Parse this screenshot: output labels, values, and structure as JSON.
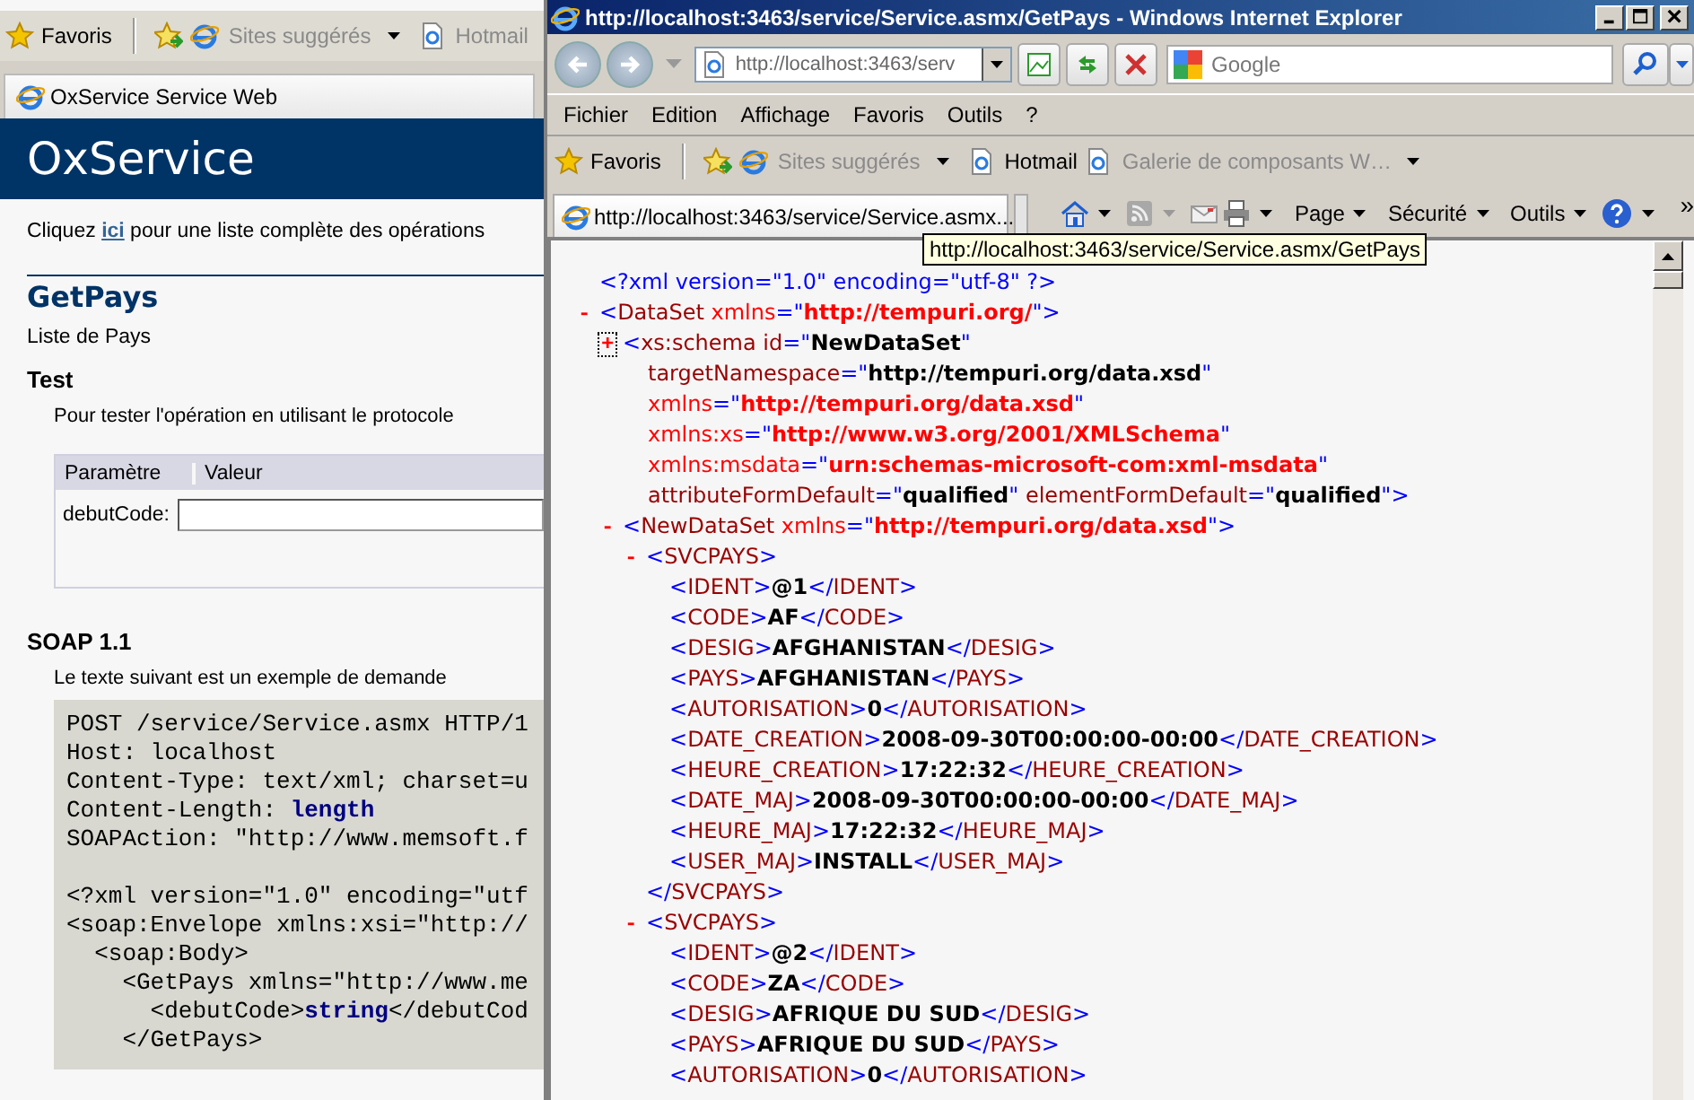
{
  "background_window": {
    "favorites_bar": {
      "favorites_label": "Favoris",
      "links": [
        {
          "label": "Sites suggérés",
          "dropdown": true
        },
        {
          "label": "Hotmail",
          "dropdown": false
        }
      ]
    },
    "tab": {
      "title": "OxService Service Web"
    },
    "page": {
      "header": "OxService",
      "intro": {
        "before": "Cliquez",
        "link": "ici",
        "after": "pour une liste complète des opérations"
      },
      "operation_title": "GetPays",
      "operation_description": "Liste de Pays",
      "test_heading": "Test",
      "test_instruction": "Pour tester l'opération en utilisant le protocole",
      "parameters_table": {
        "columns": [
          "Paramètre",
          "Valeur"
        ],
        "rows": [
          {
            "name": "debutCode:"
          }
        ]
      },
      "soap_heading": "SOAP 1.1",
      "soap_intro": "Le texte suivant est un exemple de demande",
      "soap_request_blocks": [
        [
          "POST /service/Service.asmx HTTP/1",
          "Host: localhost",
          "Content-Type: text/xml; charset=u",
          "Content-Length: **length**",
          "SOAPAction: \"http://www.memsoft.f"
        ],
        [
          "<?xml version=\"1.0\" encoding=\"utf",
          "<soap:Envelope xmlns:xsi=\"http://",
          "  <soap:Body>",
          "    <GetPays xmlns=\"http://www.me",
          "      <debutCode>**string**</debutCod",
          "    </GetPays>"
        ]
      ]
    }
  },
  "window": {
    "title": "http://localhost:3463/service/Service.asmx/GetPays - Windows Internet Explorer",
    "address_bar": {
      "url": "http://localhost:3463/serv"
    },
    "search": {
      "placeholder": "Google"
    },
    "menu": [
      "Fichier",
      "Edition",
      "Affichage",
      "Favoris",
      "Outils",
      "?"
    ],
    "favorites_bar": {
      "favorites_label": "Favoris",
      "suggested": {
        "label": "Sites suggérés",
        "disabled": true
      },
      "links": [
        {
          "label": "Hotmail",
          "disabled": false,
          "dropdown": false
        },
        {
          "label": "Galerie de composants W…",
          "disabled": true,
          "dropdown": true
        }
      ]
    },
    "tabs": [
      {
        "title": "http://localhost:3463/service/Service.asmx...",
        "selected": true
      }
    ],
    "command_menus": [
      "Page",
      "Sécurité",
      "Outils"
    ],
    "overflow": "»",
    "tooltip": "http://localhost:3463/service/Service.asmx/GetPays",
    "xml": {
      "nodes": [
        {
          "lines": [
            [
              {
                "kind": "pi",
                "text": "<?xml version=\"1.0\" encoding=\"utf-8\" ?>"
              }
            ]
          ]
        },
        {
          "toggle": "-",
          "focused": false,
          "lines": [
            [
              {
                "kind": "m",
                "text": "<"
              },
              {
                "kind": "n",
                "text": "DataSet"
              },
              {
                "kind": "ns",
                "text": " xmlns"
              },
              {
                "kind": "m",
                "text": "=\""
              },
              {
                "kind": "nsv",
                "text": "http://tempuri.org/"
              },
              {
                "kind": "m",
                "text": "\">"
              }
            ]
          ],
          "children": [
            {
              "toggle": "+",
              "focused": true,
              "lines": [
                [
                  {
                    "kind": "m",
                    "text": "<"
                  },
                  {
                    "kind": "n",
                    "text": "xs:schema"
                  },
                  {
                    "kind": "a",
                    "text": " id"
                  },
                  {
                    "kind": "m",
                    "text": "=\""
                  },
                  {
                    "kind": "v",
                    "text": "NewDataSet"
                  },
                  {
                    "kind": "m",
                    "text": "\""
                  }
                ],
                [
                  {
                    "kind": "a",
                    "text": "targetNamespace"
                  },
                  {
                    "kind": "m",
                    "text": "=\""
                  },
                  {
                    "kind": "v",
                    "text": "http://tempuri.org/data.xsd"
                  },
                  {
                    "kind": "m",
                    "text": "\""
                  }
                ],
                [
                  {
                    "kind": "ns",
                    "text": "xmlns"
                  },
                  {
                    "kind": "m",
                    "text": "=\""
                  },
                  {
                    "kind": "nsv",
                    "text": "http://tempuri.org/data.xsd"
                  },
                  {
                    "kind": "m",
                    "text": "\""
                  }
                ],
                [
                  {
                    "kind": "ns",
                    "text": "xmlns:xs"
                  },
                  {
                    "kind": "m",
                    "text": "=\""
                  },
                  {
                    "kind": "nsv",
                    "text": "http://www.w3.org/2001/XMLSchema"
                  },
                  {
                    "kind": "m",
                    "text": "\""
                  }
                ],
                [
                  {
                    "kind": "ns",
                    "text": "xmlns:msdata"
                  },
                  {
                    "kind": "m",
                    "text": "=\""
                  },
                  {
                    "kind": "nsv",
                    "text": "urn:schemas-microsoft-com:xml-msdata"
                  },
                  {
                    "kind": "m",
                    "text": "\""
                  }
                ],
                [
                  {
                    "kind": "a",
                    "text": "attributeFormDefault"
                  },
                  {
                    "kind": "m",
                    "text": "=\""
                  },
                  {
                    "kind": "v",
                    "text": "qualified"
                  },
                  {
                    "kind": "m",
                    "text": "\""
                  },
                  {
                    "kind": "a",
                    "text": " elementFormDefault"
                  },
                  {
                    "kind": "m",
                    "text": "=\""
                  },
                  {
                    "kind": "v",
                    "text": "qualified"
                  },
                  {
                    "kind": "m",
                    "text": "\">"
                  }
                ]
              ]
            },
            {
              "toggle": "-",
              "focused": false,
              "lines": [
                [
                  {
                    "kind": "m",
                    "text": "<"
                  },
                  {
                    "kind": "n",
                    "text": "NewDataSet"
                  },
                  {
                    "kind": "ns",
                    "text": " xmlns"
                  },
                  {
                    "kind": "m",
                    "text": "=\""
                  },
                  {
                    "kind": "nsv",
                    "text": "http://tempuri.org/data.xsd"
                  },
                  {
                    "kind": "m",
                    "text": "\">"
                  }
                ]
              ],
              "children": [
                {
                  "toggle": "-",
                  "focused": false,
                  "lines": [
                    [
                      {
                        "kind": "m",
                        "text": "<"
                      },
                      {
                        "kind": "n",
                        "text": "SVCPAYS"
                      },
                      {
                        "kind": "m",
                        "text": ">"
                      }
                    ]
                  ],
                  "close": [
                    {
                      "kind": "m",
                      "text": "</"
                    },
                    {
                      "kind": "n",
                      "text": "SVCPAYS"
                    },
                    {
                      "kind": "m",
                      "text": ">"
                    }
                  ],
                  "children": [
                    {
                      "lines": [
                        [
                          {
                            "kind": "m",
                            "text": "<"
                          },
                          {
                            "kind": "n",
                            "text": "IDENT"
                          },
                          {
                            "kind": "m",
                            "text": ">"
                          },
                          {
                            "kind": "t",
                            "text": "@1"
                          },
                          {
                            "kind": "m",
                            "text": "</"
                          },
                          {
                            "kind": "n",
                            "text": "IDENT"
                          },
                          {
                            "kind": "m",
                            "text": ">"
                          }
                        ]
                      ]
                    },
                    {
                      "lines": [
                        [
                          {
                            "kind": "m",
                            "text": "<"
                          },
                          {
                            "kind": "n",
                            "text": "CODE"
                          },
                          {
                            "kind": "m",
                            "text": ">"
                          },
                          {
                            "kind": "t",
                            "text": "AF"
                          },
                          {
                            "kind": "m",
                            "text": "</"
                          },
                          {
                            "kind": "n",
                            "text": "CODE"
                          },
                          {
                            "kind": "m",
                            "text": ">"
                          }
                        ]
                      ]
                    },
                    {
                      "lines": [
                        [
                          {
                            "kind": "m",
                            "text": "<"
                          },
                          {
                            "kind": "n",
                            "text": "DESIG"
                          },
                          {
                            "kind": "m",
                            "text": ">"
                          },
                          {
                            "kind": "t",
                            "text": "AFGHANISTAN"
                          },
                          {
                            "kind": "m",
                            "text": "</"
                          },
                          {
                            "kind": "n",
                            "text": "DESIG"
                          },
                          {
                            "kind": "m",
                            "text": ">"
                          }
                        ]
                      ]
                    },
                    {
                      "lines": [
                        [
                          {
                            "kind": "m",
                            "text": "<"
                          },
                          {
                            "kind": "n",
                            "text": "PAYS"
                          },
                          {
                            "kind": "m",
                            "text": ">"
                          },
                          {
                            "kind": "t",
                            "text": "AFGHANISTAN"
                          },
                          {
                            "kind": "m",
                            "text": "</"
                          },
                          {
                            "kind": "n",
                            "text": "PAYS"
                          },
                          {
                            "kind": "m",
                            "text": ">"
                          }
                        ]
                      ]
                    },
                    {
                      "lines": [
                        [
                          {
                            "kind": "m",
                            "text": "<"
                          },
                          {
                            "kind": "n",
                            "text": "AUTORISATION"
                          },
                          {
                            "kind": "m",
                            "text": ">"
                          },
                          {
                            "kind": "t",
                            "text": "0"
                          },
                          {
                            "kind": "m",
                            "text": "</"
                          },
                          {
                            "kind": "n",
                            "text": "AUTORISATION"
                          },
                          {
                            "kind": "m",
                            "text": ">"
                          }
                        ]
                      ]
                    },
                    {
                      "lines": [
                        [
                          {
                            "kind": "m",
                            "text": "<"
                          },
                          {
                            "kind": "n",
                            "text": "DATE_CREATION"
                          },
                          {
                            "kind": "m",
                            "text": ">"
                          },
                          {
                            "kind": "t",
                            "text": "2008-09-30T00:00:00-00:00"
                          },
                          {
                            "kind": "m",
                            "text": "</"
                          },
                          {
                            "kind": "n",
                            "text": "DATE_CREATION"
                          },
                          {
                            "kind": "m",
                            "text": ">"
                          }
                        ]
                      ]
                    },
                    {
                      "lines": [
                        [
                          {
                            "kind": "m",
                            "text": "<"
                          },
                          {
                            "kind": "n",
                            "text": "HEURE_CREATION"
                          },
                          {
                            "kind": "m",
                            "text": ">"
                          },
                          {
                            "kind": "t",
                            "text": "17:22:32"
                          },
                          {
                            "kind": "m",
                            "text": "</"
                          },
                          {
                            "kind": "n",
                            "text": "HEURE_CREATION"
                          },
                          {
                            "kind": "m",
                            "text": ">"
                          }
                        ]
                      ]
                    },
                    {
                      "lines": [
                        [
                          {
                            "kind": "m",
                            "text": "<"
                          },
                          {
                            "kind": "n",
                            "text": "DATE_MAJ"
                          },
                          {
                            "kind": "m",
                            "text": ">"
                          },
                          {
                            "kind": "t",
                            "text": "2008-09-30T00:00:00-00:00"
                          },
                          {
                            "kind": "m",
                            "text": "</"
                          },
                          {
                            "kind": "n",
                            "text": "DATE_MAJ"
                          },
                          {
                            "kind": "m",
                            "text": ">"
                          }
                        ]
                      ]
                    },
                    {
                      "lines": [
                        [
                          {
                            "kind": "m",
                            "text": "<"
                          },
                          {
                            "kind": "n",
                            "text": "HEURE_MAJ"
                          },
                          {
                            "kind": "m",
                            "text": ">"
                          },
                          {
                            "kind": "t",
                            "text": "17:22:32"
                          },
                          {
                            "kind": "m",
                            "text": "</"
                          },
                          {
                            "kind": "n",
                            "text": "HEURE_MAJ"
                          },
                          {
                            "kind": "m",
                            "text": ">"
                          }
                        ]
                      ]
                    },
                    {
                      "lines": [
                        [
                          {
                            "kind": "m",
                            "text": "<"
                          },
                          {
                            "kind": "n",
                            "text": "USER_MAJ"
                          },
                          {
                            "kind": "m",
                            "text": ">"
                          },
                          {
                            "kind": "t",
                            "text": "INSTALL"
                          },
                          {
                            "kind": "m",
                            "text": "</"
                          },
                          {
                            "kind": "n",
                            "text": "USER_MAJ"
                          },
                          {
                            "kind": "m",
                            "text": ">"
                          }
                        ]
                      ]
                    }
                  ]
                },
                {
                  "toggle": "-",
                  "focused": false,
                  "lines": [
                    [
                      {
                        "kind": "m",
                        "text": "<"
                      },
                      {
                        "kind": "n",
                        "text": "SVCPAYS"
                      },
                      {
                        "kind": "m",
                        "text": ">"
                      }
                    ]
                  ],
                  "children": [
                    {
                      "lines": [
                        [
                          {
                            "kind": "m",
                            "text": "<"
                          },
                          {
                            "kind": "n",
                            "text": "IDENT"
                          },
                          {
                            "kind": "m",
                            "text": ">"
                          },
                          {
                            "kind": "t",
                            "text": "@2"
                          },
                          {
                            "kind": "m",
                            "text": "</"
                          },
                          {
                            "kind": "n",
                            "text": "IDENT"
                          },
                          {
                            "kind": "m",
                            "text": ">"
                          }
                        ]
                      ]
                    },
                    {
                      "lines": [
                        [
                          {
                            "kind": "m",
                            "text": "<"
                          },
                          {
                            "kind": "n",
                            "text": "CODE"
                          },
                          {
                            "kind": "m",
                            "text": ">"
                          },
                          {
                            "kind": "t",
                            "text": "ZA"
                          },
                          {
                            "kind": "m",
                            "text": "</"
                          },
                          {
                            "kind": "n",
                            "text": "CODE"
                          },
                          {
                            "kind": "m",
                            "text": ">"
                          }
                        ]
                      ]
                    },
                    {
                      "lines": [
                        [
                          {
                            "kind": "m",
                            "text": "<"
                          },
                          {
                            "kind": "n",
                            "text": "DESIG"
                          },
                          {
                            "kind": "m",
                            "text": ">"
                          },
                          {
                            "kind": "t",
                            "text": "AFRIQUE DU SUD"
                          },
                          {
                            "kind": "m",
                            "text": "</"
                          },
                          {
                            "kind": "n",
                            "text": "DESIG"
                          },
                          {
                            "kind": "m",
                            "text": ">"
                          }
                        ]
                      ]
                    },
                    {
                      "lines": [
                        [
                          {
                            "kind": "m",
                            "text": "<"
                          },
                          {
                            "kind": "n",
                            "text": "PAYS"
                          },
                          {
                            "kind": "m",
                            "text": ">"
                          },
                          {
                            "kind": "t",
                            "text": "AFRIQUE DU SUD"
                          },
                          {
                            "kind": "m",
                            "text": "</"
                          },
                          {
                            "kind": "n",
                            "text": "PAYS"
                          },
                          {
                            "kind": "m",
                            "text": ">"
                          }
                        ]
                      ]
                    },
                    {
                      "lines": [
                        [
                          {
                            "kind": "m",
                            "text": "<"
                          },
                          {
                            "kind": "n",
                            "text": "AUTORISATION"
                          },
                          {
                            "kind": "m",
                            "text": ">"
                          },
                          {
                            "kind": "t",
                            "text": "0"
                          },
                          {
                            "kind": "m",
                            "text": "</"
                          },
                          {
                            "kind": "n",
                            "text": "AUTORISATION"
                          },
                          {
                            "kind": "m",
                            "text": ">"
                          }
                        ]
                      ]
                    }
                  ]
                }
              ]
            }
          ]
        }
      ]
    }
  }
}
